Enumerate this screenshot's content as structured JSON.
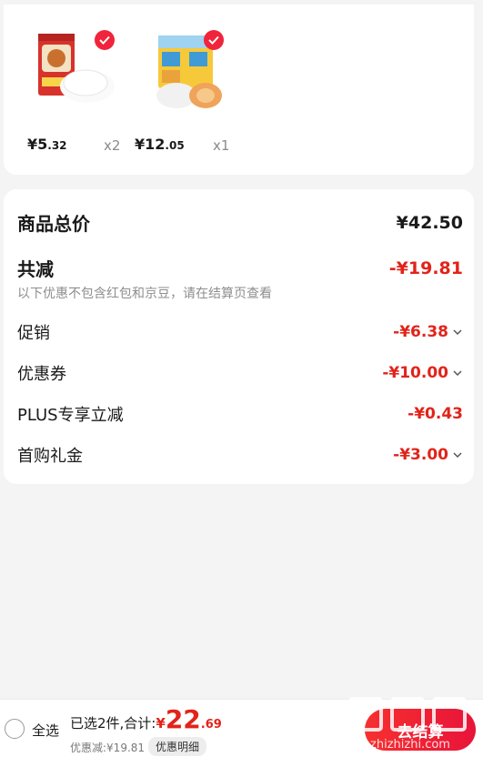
{
  "products": [
    {
      "price_int": "¥5",
      "price_dec": ".32",
      "qty": "x2"
    },
    {
      "price_int": "¥12",
      "price_dec": ".05",
      "qty": "x1"
    }
  ],
  "summary": {
    "total_label": "商品总价",
    "total_value": "¥42.50",
    "reduce_label": "共减",
    "reduce_value": "-¥19.81",
    "note": "以下优惠不包含红包和京豆，请在结算页查看",
    "items": [
      {
        "label": "促销",
        "value": "-¥6.38"
      },
      {
        "label": "优惠券",
        "value": "-¥10.00"
      },
      {
        "label": "PLUS专享立减",
        "value": "-¥0.43"
      },
      {
        "label": "首购礼金",
        "value": "-¥3.00"
      }
    ]
  },
  "bottom": {
    "select_all": "全选",
    "selected_text": "已选2件,合计:",
    "yen": "¥",
    "total_int": "22",
    "total_dec": ".69",
    "discount_text": "优惠减:¥19.81",
    "detail_chip": "优惠明细",
    "checkout": "去结算"
  },
  "watermark": "值 什么值得买 zhizhizhi.com",
  "colors": {
    "accent": "#e2231a",
    "check": "#f0243a",
    "background": "#f4f4f4"
  }
}
